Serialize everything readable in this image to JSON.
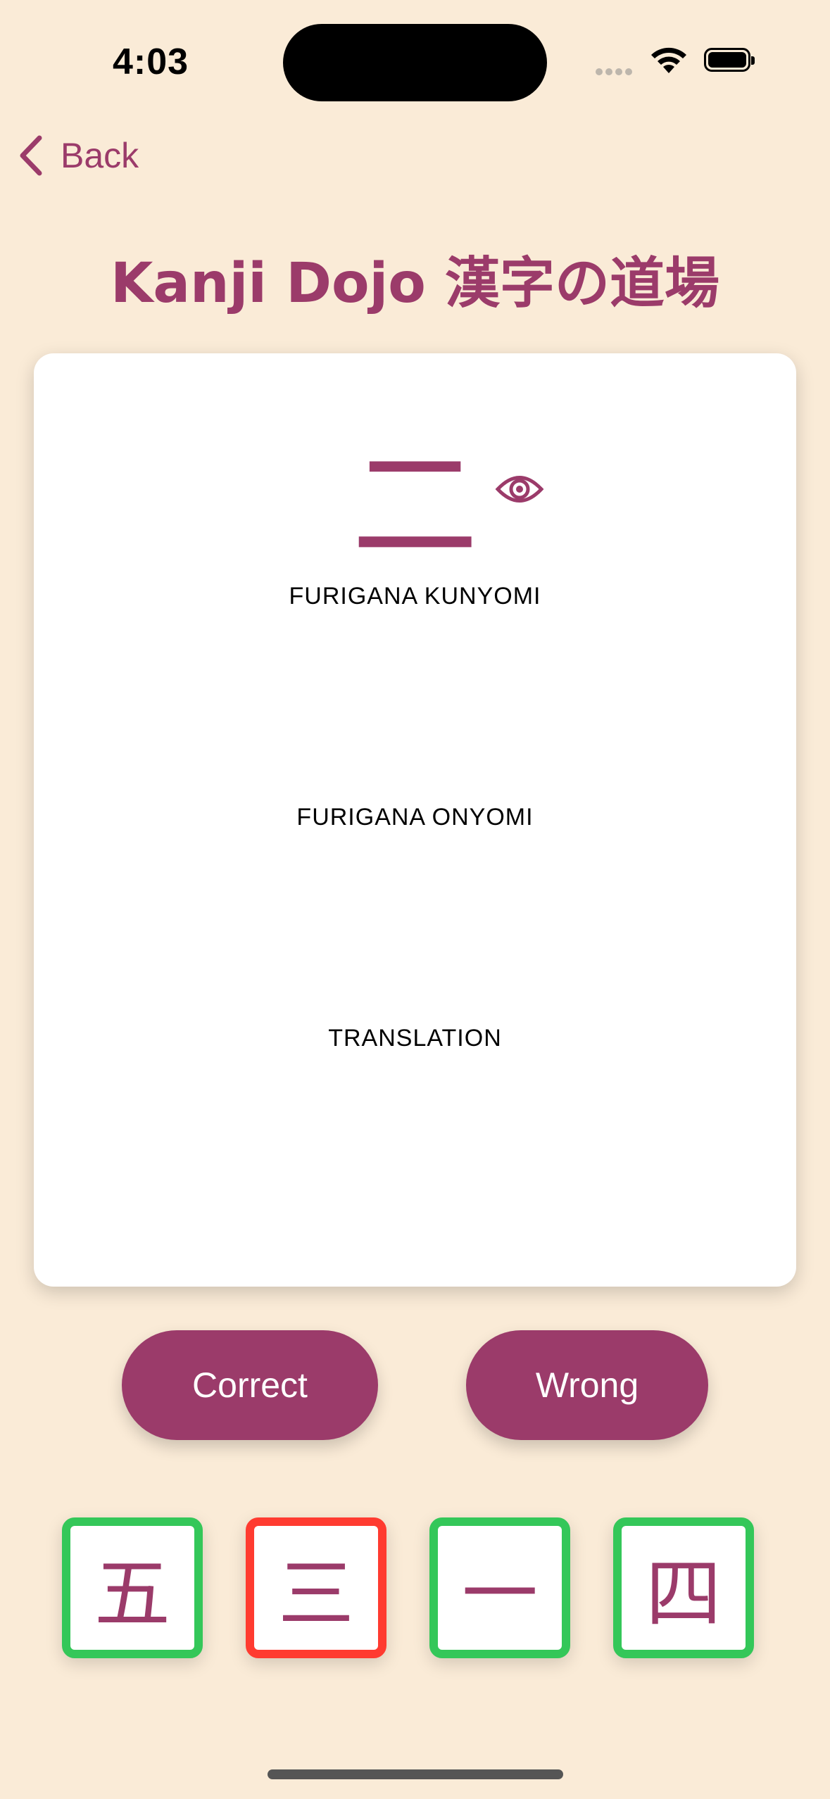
{
  "status": {
    "time": "4:03"
  },
  "nav": {
    "back_label": "Back"
  },
  "title": "Kanji Dojo 漢字の道場",
  "card": {
    "kanji": "二",
    "kunyomi": "FURIGANA KUNYOMI",
    "onyomi": "FURIGANA ONYOMI",
    "translation": "TRANSLATION"
  },
  "buttons": {
    "correct": "Correct",
    "wrong": "Wrong"
  },
  "history": [
    {
      "kanji": "五",
      "status": "correct",
      "color": "#34C759"
    },
    {
      "kanji": "三",
      "status": "wrong",
      "color": "#FF3B30"
    },
    {
      "kanji": "一",
      "status": "correct",
      "color": "#34C759"
    },
    {
      "kanji": "四",
      "status": "correct",
      "color": "#34C759"
    }
  ],
  "colors": {
    "accent": "#9B3B6A",
    "background": "#FAEBD7",
    "correct": "#34C759",
    "wrong": "#FF3B30"
  }
}
